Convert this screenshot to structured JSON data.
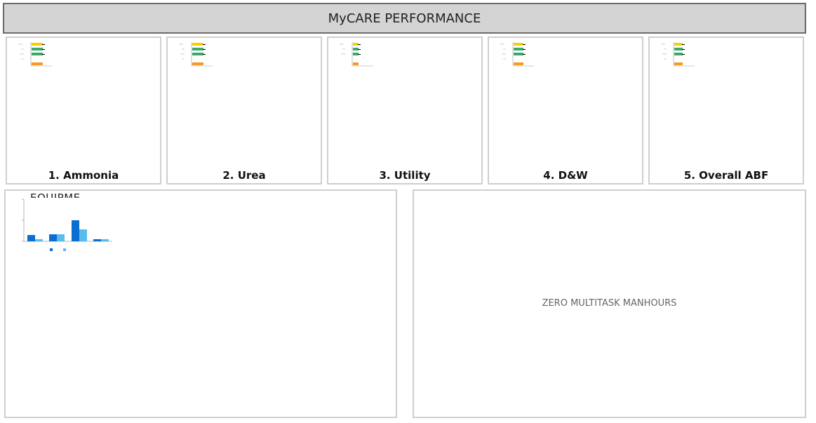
{
  "header": {
    "title": "MyCARE PERFORMANCE"
  },
  "cards": [
    {
      "label": "1. Ammonia"
    },
    {
      "label": "2. Urea"
    },
    {
      "label": "3. Utility"
    },
    {
      "label": "4. D&W"
    },
    {
      "label": "5. Overall ABF"
    }
  ],
  "left_panel": {
    "title": "EQUIPME"
  },
  "right_panel": {
    "message": "ZERO MULTITASK MANHOURS"
  },
  "colors": {
    "yellow": "#f5d000",
    "green": "#3aaa6a",
    "orange": "#f59a23",
    "blue_dark": "#0a6fd0",
    "blue_light": "#5bbcec"
  }
}
